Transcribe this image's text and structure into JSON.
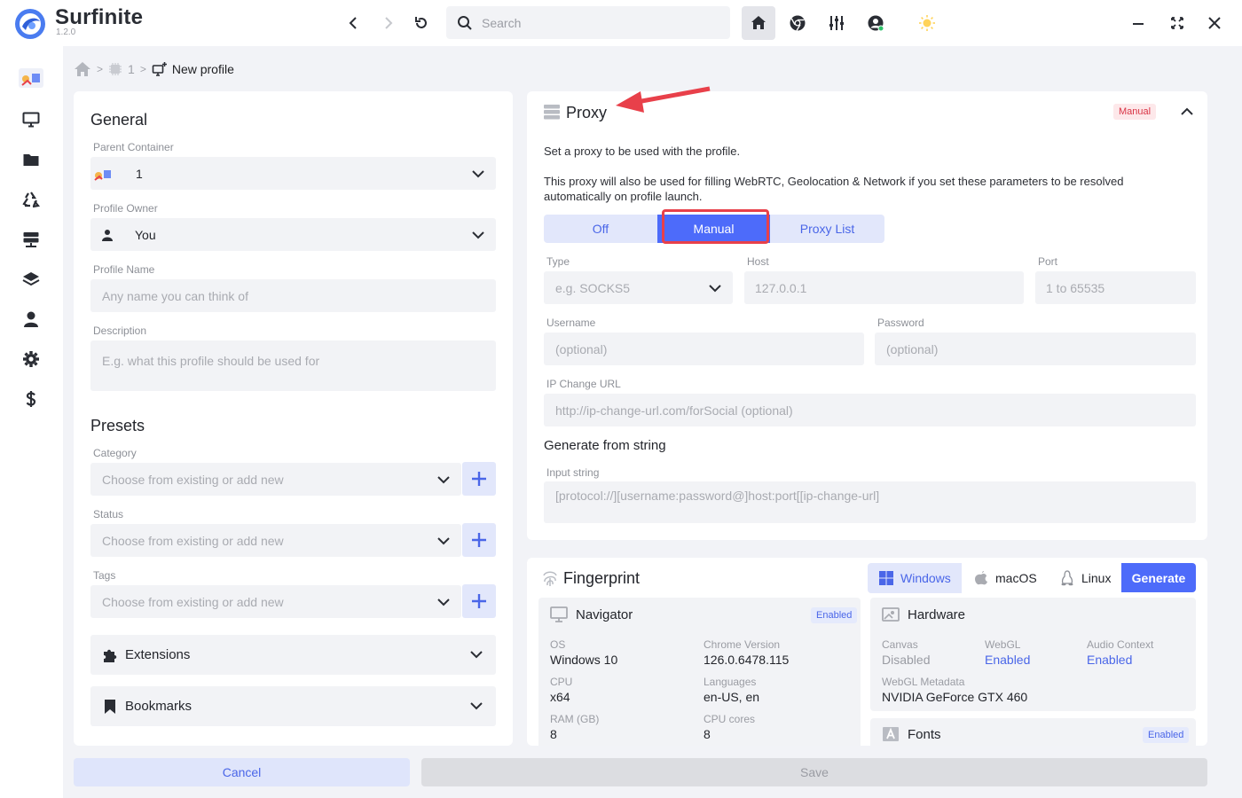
{
  "app": {
    "name": "Surfinite",
    "version": "1.2.0"
  },
  "header": {
    "search_placeholder": "Search"
  },
  "breadcrumb": {
    "container": "1",
    "current": "New profile"
  },
  "general": {
    "title": "General",
    "parent_container": {
      "label": "Parent Container",
      "value": "1"
    },
    "profile_owner": {
      "label": "Profile Owner",
      "value": "You"
    },
    "profile_name": {
      "label": "Profile Name",
      "placeholder": "Any name you can think of"
    },
    "description": {
      "label": "Description",
      "placeholder": "E.g. what this profile should be used for"
    }
  },
  "presets": {
    "title": "Presets",
    "category": {
      "label": "Category",
      "placeholder": "Choose from existing or add new"
    },
    "status": {
      "label": "Status",
      "placeholder": "Choose from existing or add new"
    },
    "tags": {
      "label": "Tags",
      "placeholder": "Choose from existing or add new"
    }
  },
  "extensions_label": "Extensions",
  "bookmarks_label": "Bookmarks",
  "proxy": {
    "title": "Proxy",
    "badge": "Manual",
    "desc1": "Set a proxy to be used with the profile.",
    "desc2": "This proxy will also be used for filling WebRTC, Geolocation & Network if you set these parameters to be resolved automatically on profile launch.",
    "modes": {
      "off": "Off",
      "manual": "Manual",
      "list": "Proxy List"
    },
    "type": {
      "label": "Type",
      "placeholder": "e.g. SOCKS5"
    },
    "host": {
      "label": "Host",
      "placeholder": "127.0.0.1"
    },
    "port": {
      "label": "Port",
      "placeholder": "1 to 65535"
    },
    "username": {
      "label": "Username",
      "placeholder": "(optional)"
    },
    "password": {
      "label": "Password",
      "placeholder": "(optional)"
    },
    "ip_change": {
      "label": "IP Change URL",
      "placeholder": "http://ip-change-url.com/forSocial (optional)"
    },
    "generate_title": "Generate from string",
    "input_string": {
      "label": "Input string",
      "placeholder": "[protocol://][username:password@]host:port[[ip-change-url]"
    }
  },
  "fingerprint": {
    "title": "Fingerprint",
    "os_tabs": {
      "windows": "Windows",
      "macos": "macOS",
      "linux": "Linux"
    },
    "generate": "Generate",
    "navigator": {
      "title": "Navigator",
      "badge": "Enabled",
      "os_label": "OS",
      "os_value": "Windows 10",
      "chrome_label": "Chrome Version",
      "chrome_value": "126.0.6478.115",
      "cpu_label": "CPU",
      "cpu_value": "x64",
      "lang_label": "Languages",
      "lang_value": "en-US, en",
      "ram_label": "RAM (GB)",
      "ram_value": "8",
      "cores_label": "CPU cores",
      "cores_value": "8"
    },
    "hardware": {
      "title": "Hardware",
      "canvas_label": "Canvas",
      "canvas_value": "Disabled",
      "webgl_label": "WebGL",
      "webgl_value": "Enabled",
      "audio_label": "Audio Context",
      "audio_value": "Enabled",
      "meta_label": "WebGL Metadata",
      "meta_value": "NVIDIA GeForce GTX 460"
    },
    "fonts": {
      "title": "Fonts",
      "badge": "Enabled"
    }
  },
  "footer": {
    "cancel": "Cancel",
    "save": "Save"
  },
  "colors": {
    "accent": "#4d6bfa",
    "accent_light": "#e2e7fb",
    "danger": "#e8404a"
  }
}
